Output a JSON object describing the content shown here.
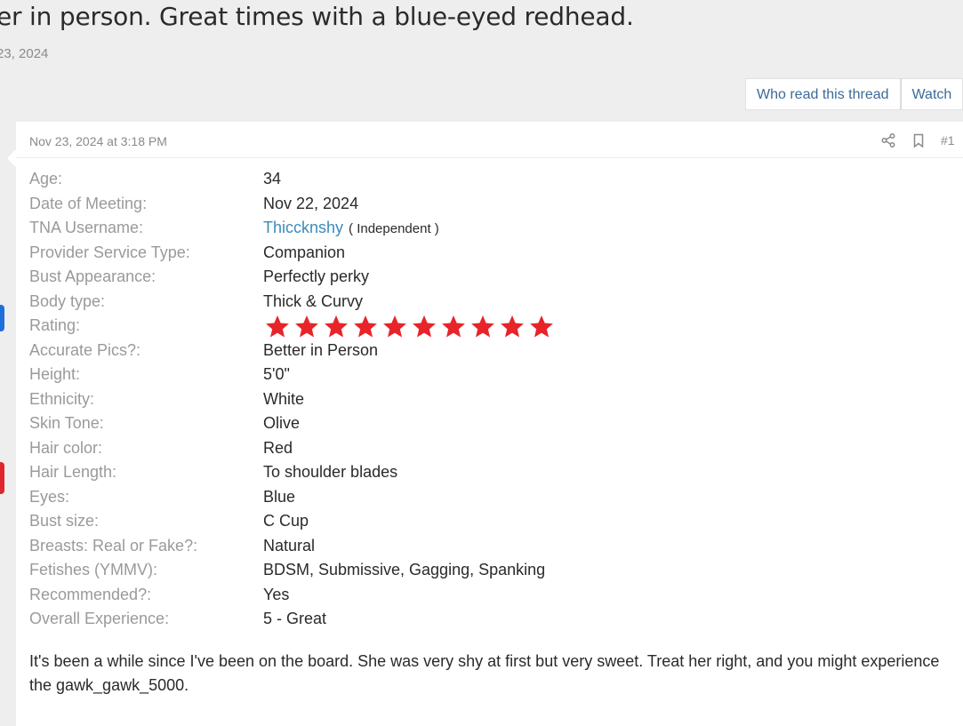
{
  "thread": {
    "title": "er in person. Great times with a blue-eyed redhead.",
    "date": "23, 2024"
  },
  "thread_actions": [
    "Who read this thread",
    "Watch"
  ],
  "post": {
    "date": "Nov 23, 2024 at 3:18 PM",
    "number": "#1",
    "fields": [
      {
        "label": "Age:",
        "value": "34"
      },
      {
        "label": "Date of Meeting:",
        "value": "Nov 22, 2024"
      },
      {
        "label": "TNA Username:",
        "value": "Thiccknshy",
        "tag": "( Independent )"
      },
      {
        "label": "Provider Service Type:",
        "value": "Companion"
      },
      {
        "label": "Bust Appearance:",
        "value": "Perfectly perky"
      },
      {
        "label": "Body type:",
        "value": "Thick & Curvy"
      },
      {
        "label": "Rating:",
        "rating": 10
      },
      {
        "label": "Accurate Pics?:",
        "value": "Better in Person"
      },
      {
        "label": "Height:",
        "value": "5'0\""
      },
      {
        "label": "Ethnicity:",
        "value": "White"
      },
      {
        "label": "Skin Tone:",
        "value": "Olive"
      },
      {
        "label": "Hair color:",
        "value": "Red"
      },
      {
        "label": "Hair Length:",
        "value": "To shoulder blades"
      },
      {
        "label": "Eyes:",
        "value": "Blue"
      },
      {
        "label": "Bust size:",
        "value": "C Cup"
      },
      {
        "label": "Breasts: Real or Fake?:",
        "value": "Natural"
      },
      {
        "label": "Fetishes (YMMV):",
        "value": "BDSM, Submissive, Gagging, Spanking"
      },
      {
        "label": "Recommended?:",
        "value": "Yes"
      },
      {
        "label": "Overall Experience:",
        "value": "5 - Great"
      }
    ],
    "body": "It's been a while since I've been on the board. She was very shy at first but very sweet. Treat her right, and you might experience the gawk_gawk_5000."
  },
  "icons": {
    "share": "share-icon",
    "bookmark": "bookmark-icon",
    "star": "star-icon"
  },
  "colors": {
    "star": "#e8242b",
    "link": "#3d8ab8",
    "badge_blue": "#1e6fd9",
    "badge_red": "#e0262c"
  }
}
